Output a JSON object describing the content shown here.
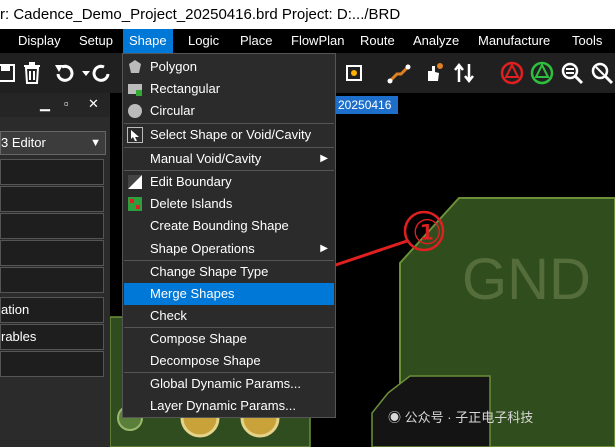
{
  "window": {
    "title": "r: Cadence_Demo_Project_20250416.brd  Project: D:.../BRD"
  },
  "menubar": {
    "items": [
      "Display",
      "Setup",
      "Shape",
      "Logic",
      "Place",
      "FlowPlan",
      "Route",
      "Analyze",
      "Manufacture",
      "Tools"
    ],
    "active": "Shape"
  },
  "panel": {
    "editor_label": "3 Editor",
    "rows": [
      "",
      "",
      "",
      "",
      "",
      "ation",
      "rables",
      ""
    ]
  },
  "canvas": {
    "tab_label": "20250416",
    "gnd_label": "GND",
    "annotation_number": "①"
  },
  "shape_menu": {
    "items": [
      {
        "label": "Polygon"
      },
      {
        "label": "Rectangular"
      },
      {
        "label": "Circular"
      },
      {
        "label": "Select Shape or Void/Cavity"
      },
      {
        "label": "Manual Void/Cavity"
      },
      {
        "label": "Edit Boundary"
      },
      {
        "label": "Delete Islands"
      },
      {
        "label": "Create Bounding Shape"
      },
      {
        "label": "Shape Operations"
      },
      {
        "label": "Change Shape Type"
      },
      {
        "label": "Merge Shapes"
      },
      {
        "label": "Check"
      },
      {
        "label": "Compose Shape"
      },
      {
        "label": "Decompose Shape"
      },
      {
        "label": "Global Dynamic Params..."
      },
      {
        "label": "Layer Dynamic Params..."
      }
    ],
    "selected": "Merge Shapes"
  },
  "watermark": {
    "text": "公众号 · 子正电子科技"
  },
  "colors": {
    "menu_highlight": "#0078d7",
    "board_green": "#2f4d1d",
    "arrow_red": "#e02020"
  }
}
